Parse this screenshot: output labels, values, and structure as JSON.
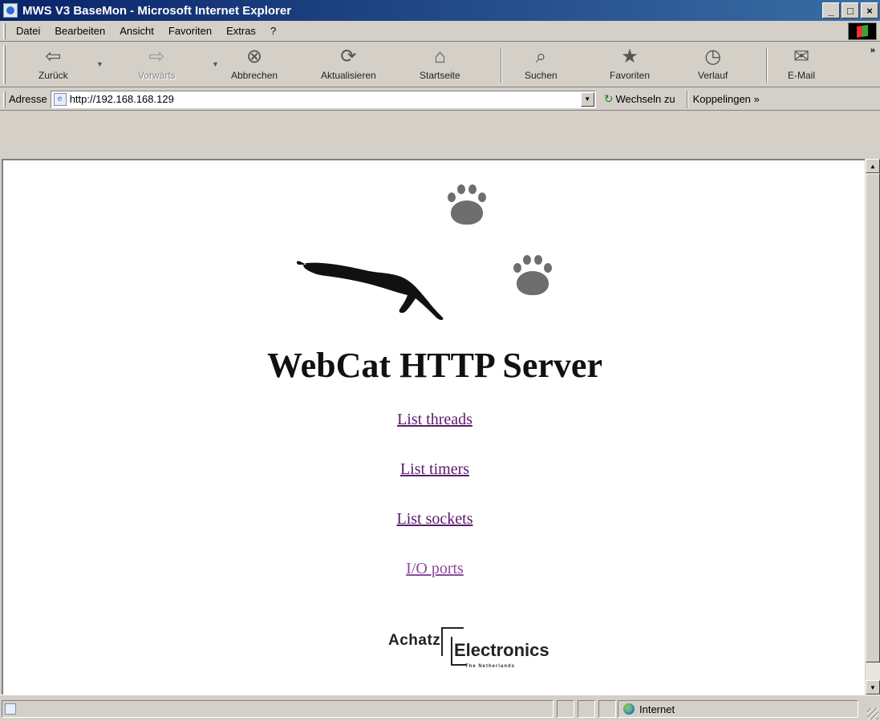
{
  "window": {
    "title": "MWS V3 BaseMon - Microsoft Internet Explorer",
    "minimize": "_",
    "maximize": "□",
    "close": "×"
  },
  "menu": {
    "items": [
      "Datei",
      "Bearbeiten",
      "Ansicht",
      "Favoriten",
      "Extras",
      "?"
    ]
  },
  "toolbar": {
    "back": "Zurück",
    "forward": "Vorwärts",
    "stop": "Abbrechen",
    "refresh": "Aktualisieren",
    "home": "Startseite",
    "search": "Suchen",
    "favorites": "Favoriten",
    "history": "Verlauf",
    "mail": "E-Mail",
    "more": "»"
  },
  "address": {
    "label": "Adresse",
    "value": "http://192.168.168.129",
    "go": "Wechseln zu",
    "links": "Koppelingen »"
  },
  "page": {
    "title": "WebCat HTTP Server",
    "links": [
      "List threads",
      "List timers",
      "List sockets",
      "I/O ports"
    ],
    "logo": {
      "name": "Achatz",
      "name2": "Electronics",
      "sub": "The Netherlands"
    }
  },
  "status": {
    "zone": "Internet"
  },
  "icons": {
    "back": "arrow-left-icon",
    "forward": "arrow-right-icon",
    "stop": "stop-icon",
    "refresh": "refresh-icon",
    "home": "home-icon",
    "search": "search-icon",
    "favorites": "favorites-icon",
    "history": "history-icon",
    "mail": "mail-icon"
  }
}
